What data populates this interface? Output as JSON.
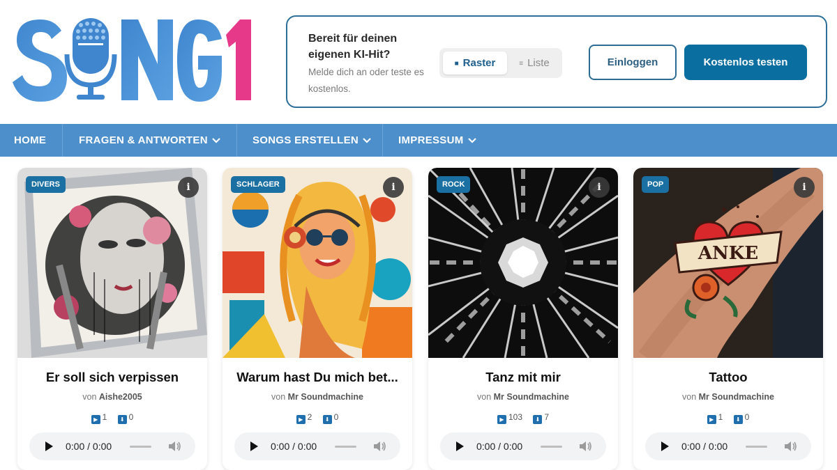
{
  "logo": {
    "text": "SNG1",
    "alt_letter": "O as microphone"
  },
  "promo": {
    "title": "Bereit für deinen eigenen KI-Hit?",
    "subtitle": "Melde dich an oder teste es kostenlos.",
    "view_toggle": {
      "raster_label": "Raster",
      "liste_label": "Liste",
      "raster_icon": "■",
      "liste_icon": "≡",
      "selected": "Raster"
    },
    "login_label": "Einloggen",
    "trial_label": "Kostenlos testen"
  },
  "nav": {
    "items": [
      {
        "label": "HOME",
        "dropdown": false
      },
      {
        "label": "FRAGEN & ANTWORTEN",
        "dropdown": true
      },
      {
        "label": "SONGS ERSTELLEN",
        "dropdown": true
      },
      {
        "label": "IMPRESSUM",
        "dropdown": true
      }
    ],
    "chevron": "⌄"
  },
  "songs": [
    {
      "genre": "DIVERS",
      "title": "Er soll sich verpissen",
      "by": "von",
      "author": "Aishe2005",
      "plays": "1",
      "downloads": "0",
      "time": "0:00 / 0:00",
      "art_icon": "cd-case-portrait-art"
    },
    {
      "genre": "SCHLAGER",
      "title": "Warum hast Du mich bet...",
      "by": "von",
      "author": "Mr Soundmachine",
      "plays": "2",
      "downloads": "0",
      "time": "0:00 / 0:00",
      "art_icon": "woman-headphones-art"
    },
    {
      "genre": "ROCK",
      "title": "Tanz mit mir",
      "by": "von",
      "author": "Mr Soundmachine",
      "plays": "103",
      "downloads": "7",
      "time": "0:00 / 0:00",
      "art_icon": "black-white-burst-art"
    },
    {
      "genre": "POP",
      "title": "Tattoo",
      "by": "von",
      "author": "Mr Soundmachine",
      "plays": "1",
      "downloads": "0",
      "time": "0:00 / 0:00",
      "art_icon": "heart-tattoo-art",
      "tattoo_text": "ANKE"
    }
  ],
  "icons": {
    "info": "i",
    "play_count": "▶",
    "download": "⬇"
  },
  "colors": {
    "brand_blue": "#4c8fcb",
    "logo_pink": "#e6398a",
    "accent_dark": "#0b6ea0"
  }
}
